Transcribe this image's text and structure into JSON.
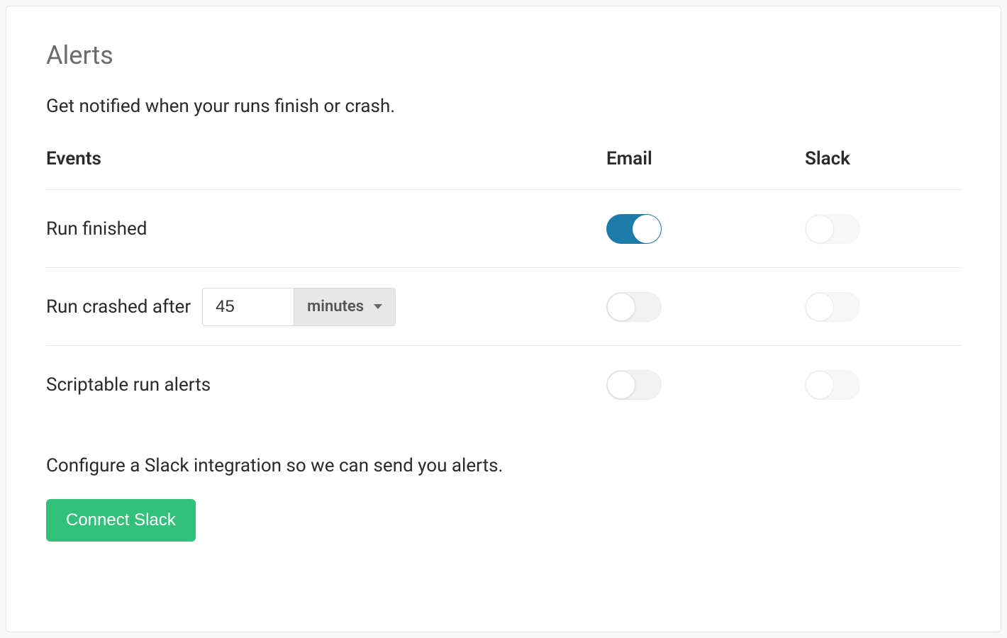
{
  "title": "Alerts",
  "subtitle": "Get notified when your runs finish or crash.",
  "columns": {
    "events": "Events",
    "email": "Email",
    "slack": "Slack"
  },
  "rows": [
    {
      "label": "Run finished",
      "email_on": true,
      "slack_on": false,
      "slack_disabled": true
    },
    {
      "label": "Run crashed after",
      "duration_value": "45",
      "duration_unit": "minutes",
      "email_on": false,
      "slack_on": false,
      "slack_disabled": true
    },
    {
      "label": "Scriptable run alerts",
      "email_on": false,
      "slack_on": false,
      "slack_disabled": true
    }
  ],
  "footer_text": "Configure a Slack integration so we can send you alerts.",
  "connect_button": "Connect Slack"
}
